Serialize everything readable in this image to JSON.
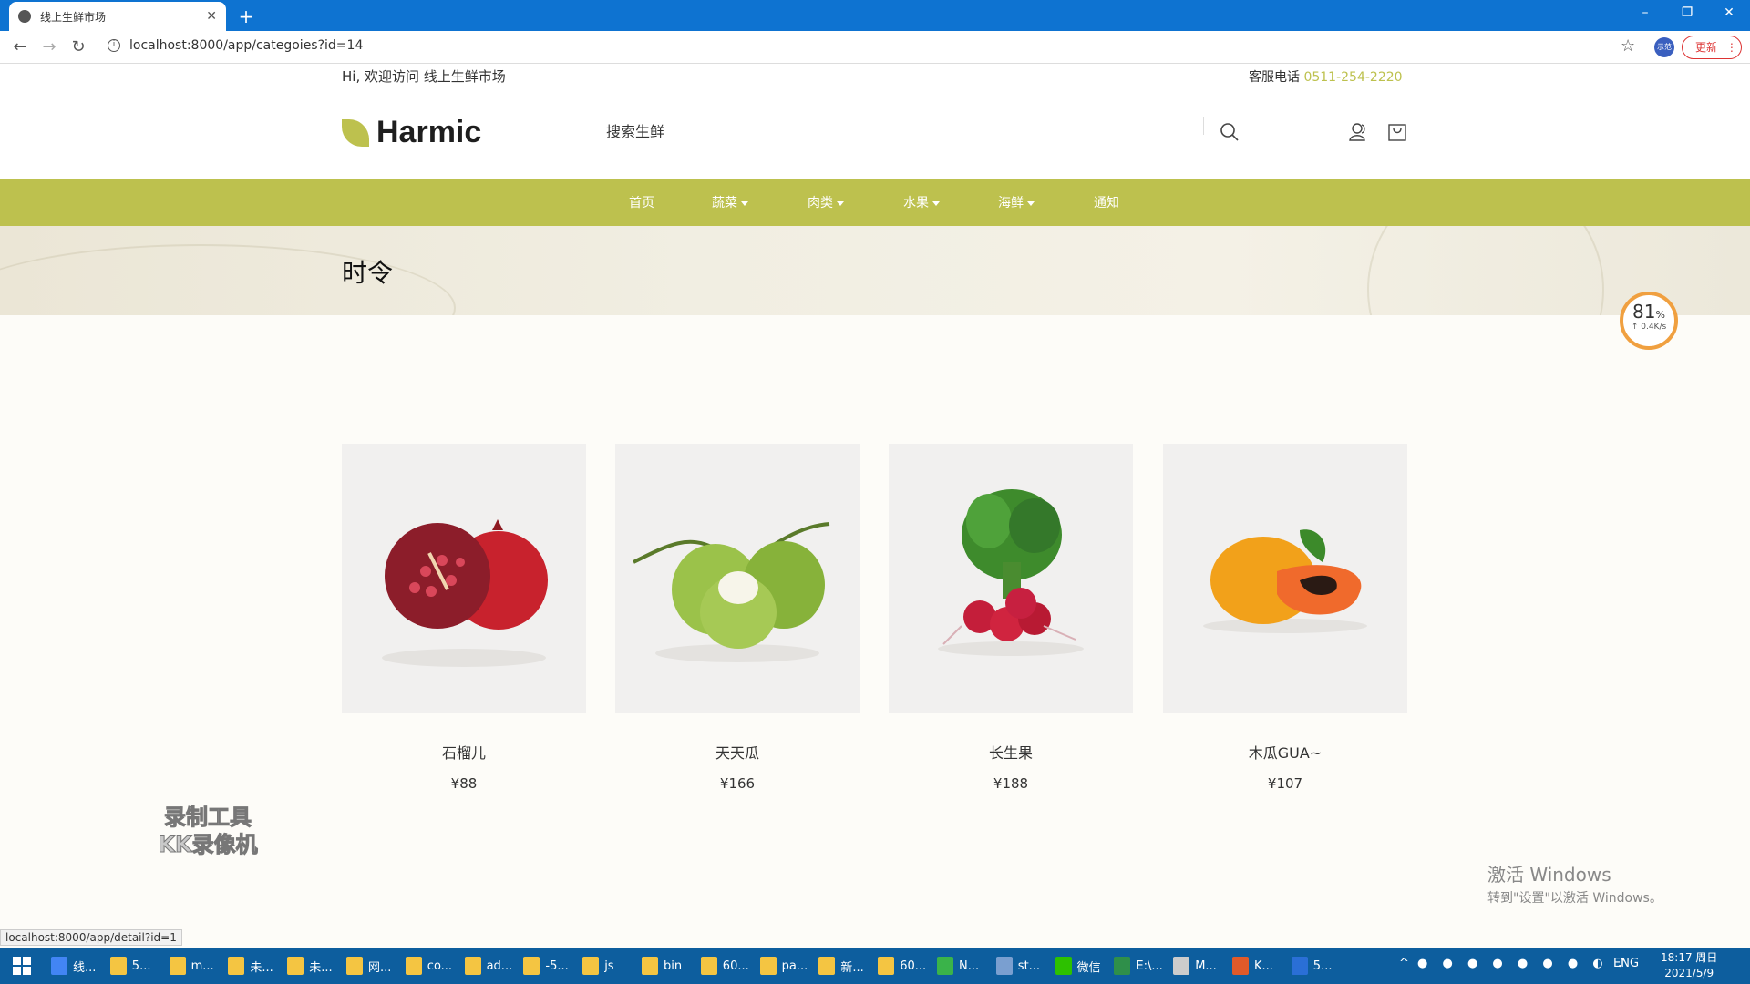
{
  "browser": {
    "tab_title": "线上生鲜市场",
    "url": "localhost:8000/app/categoies?id=14",
    "update_label": "更新",
    "profile_label": "示范"
  },
  "site": {
    "welcome": "Hi, 欢迎访问 线上生鲜市场",
    "hotline_label": "客服电话",
    "hotline_number": "0511-254-2220",
    "brand": "Harmic",
    "search_placeholder": "搜索生鲜",
    "nav": {
      "home": "首页",
      "vegetables": "蔬菜",
      "meat": "肉类",
      "fruit": "水果",
      "seafood": "海鲜",
      "notice": "通知"
    },
    "page_title": "时令",
    "accent_color": "#bdc14e"
  },
  "products": [
    {
      "name": "石榴儿",
      "price": "¥88",
      "icon": "pomegranate"
    },
    {
      "name": "天天瓜",
      "price": "¥166",
      "icon": "coconut"
    },
    {
      "name": "长生果",
      "price": "¥188",
      "icon": "radish"
    },
    {
      "name": "木瓜GUA~",
      "price": "¥107",
      "icon": "papaya"
    }
  ],
  "overlay": {
    "speed_pct": "81",
    "speed_unit": "%",
    "speed_rate": "↑ 0.4K/s",
    "kk_line1": "录制工具",
    "kk_line2": "KK录像机",
    "activate_l1": "激活 Windows",
    "activate_l2": "转到\"设置\"以激活 Windows。",
    "status_url": "localhost:8000/app/detail?id=1"
  },
  "taskbar": {
    "items": [
      "线...",
      "5...",
      "m...",
      "未...",
      "未...",
      "网...",
      "co...",
      "ad...",
      "-5...",
      "js",
      "bin",
      "60...",
      "pa...",
      "新...",
      "60...",
      "N...",
      "st...",
      "微信",
      "E:\\...",
      "M...",
      "K...",
      "5..."
    ],
    "lang": "ENG",
    "time": "18:17 周日",
    "date": "2021/5/9"
  }
}
